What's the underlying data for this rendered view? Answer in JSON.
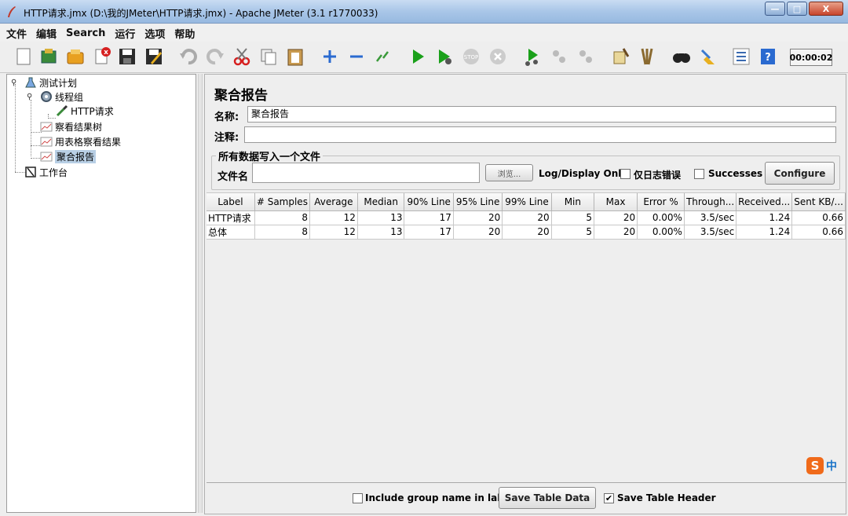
{
  "window": {
    "title": "HTTP请求.jmx (D:\\我的JMeter\\HTTP请求.jmx) - Apache JMeter (3.1 r1770033)",
    "minimize": "—",
    "maximize": "□",
    "close": "X"
  },
  "menu": [
    "文件",
    "编辑",
    "Search",
    "运行",
    "选项",
    "帮助"
  ],
  "toolbar": {
    "icons": [
      "new-icon",
      "templates-icon",
      "open-icon",
      "close-icon",
      "save-icon",
      "save-as-icon",
      "undo-icon",
      "redo-icon",
      "cut-icon",
      "copy-icon",
      "paste-icon",
      "expand-icon",
      "collapse-icon",
      "toggle-icon",
      "start-icon",
      "start-no-pause-icon",
      "stop-icon",
      "shutdown-icon",
      "remote-start-icon",
      "remote-stop-icon",
      "remote-shutdown-icon",
      "clear-icon",
      "clear-all-icon",
      "search-icon",
      "reset-search-icon",
      "function-helper-icon",
      "help-icon"
    ],
    "timer": "00:00:02"
  },
  "tree": {
    "test_plan": "测试计划",
    "thread_group": "线程组",
    "http_request": "HTTP请求",
    "view_results_tree": "察看结果树",
    "view_results_table": "用表格察看结果",
    "aggregate_report": "聚合报告",
    "workbench": "工作台"
  },
  "panel": {
    "title": "聚合报告",
    "name_label": "名称:",
    "name_value": "聚合报告",
    "comment_label": "注释:",
    "comment_value": "",
    "file_group_title": "所有数据写入一个文件",
    "filename_label": "文件名",
    "filename_value": "",
    "browse_label": "浏览...",
    "log_display_only": "Log/Display Only:",
    "errors_only_label": "仅日志错误",
    "successes_label": "Successes",
    "configure_label": "Configure"
  },
  "table": {
    "columns": [
      "Label",
      "# Samples",
      "Average",
      "Median",
      "90% Line",
      "95% Line",
      "99% Line",
      "Min",
      "Max",
      "Error %",
      "Through...",
      "Received...",
      "Sent KB/..."
    ],
    "rows": [
      [
        "HTTP请求",
        "8",
        "12",
        "13",
        "17",
        "20",
        "20",
        "5",
        "20",
        "0.00%",
        "3.5/sec",
        "1.24",
        "0.66"
      ],
      [
        "总体",
        "8",
        "12",
        "13",
        "17",
        "20",
        "20",
        "5",
        "20",
        "0.00%",
        "3.5/sec",
        "1.24",
        "0.66"
      ]
    ]
  },
  "bottom": {
    "include_group_label": "Include group name in label?",
    "include_group_checked": false,
    "save_table_data": "Save Table Data",
    "save_table_header": "Save Table Header",
    "save_table_header_checked": true
  },
  "ime": {
    "logo": "S",
    "mode": "中"
  }
}
